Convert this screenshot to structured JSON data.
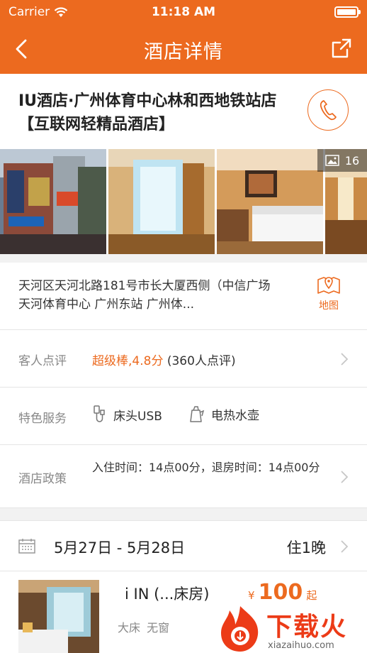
{
  "status_bar": {
    "carrier": "Carrier",
    "time": "11:18 AM"
  },
  "nav": {
    "title": "酒店详情"
  },
  "hotel": {
    "name": "IU酒店·广州体育中心林和西地铁站店【互联网轻精品酒店】"
  },
  "gallery": {
    "photo_count": "16"
  },
  "address": {
    "text": "天河区天河北路181号市长大厦西侧（中信广场 天河体育中心 广州东站 广州体...",
    "map_label": "地图"
  },
  "review": {
    "label": "客人点评",
    "score_text": "超级棒,4.8分",
    "count_text": "(360人点评)"
  },
  "services": {
    "label": "特色服务",
    "items": [
      {
        "name": "床头USB",
        "icon": "usb-icon"
      },
      {
        "name": "电热水壶",
        "icon": "kettle-icon"
      }
    ]
  },
  "policy": {
    "label": "酒店政策",
    "text": "入住时间：14点00分，退房时间：14点00分"
  },
  "dates": {
    "range": "5月27日 - 5月28日",
    "nights": "住1晚"
  },
  "room": {
    "name": "i IN (...床房)",
    "tags": "大床 无窗",
    "currency": "¥",
    "price": "100",
    "price_suffix": "起"
  },
  "watermark": {
    "brand": "下载火",
    "url": "xiazaihuo.com"
  },
  "colors": {
    "accent": "#ec6a1f",
    "battery_level": 1.0
  }
}
